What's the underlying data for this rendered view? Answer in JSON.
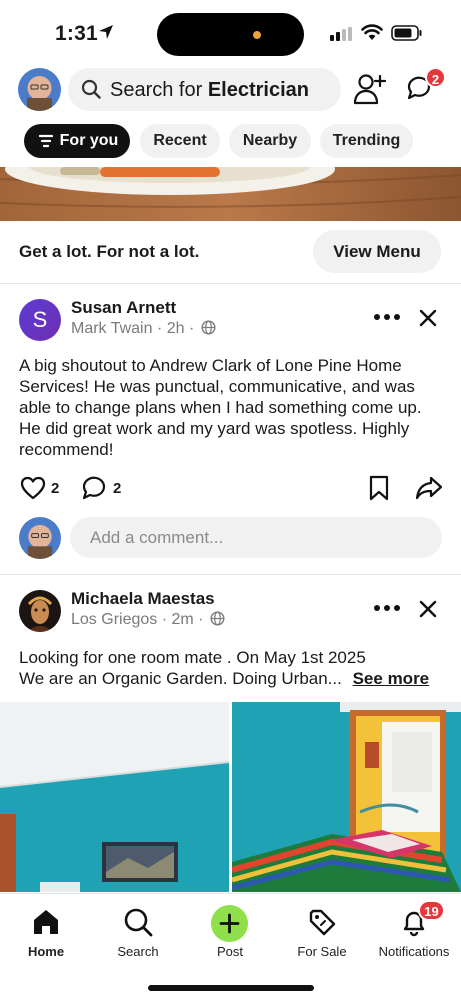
{
  "status_bar": {
    "time": "1:31"
  },
  "header": {
    "search_prefix": "Search for ",
    "search_term": "Electrician",
    "chat_badge": "2"
  },
  "chips": [
    {
      "label": "For you",
      "active": true
    },
    {
      "label": "Recent"
    },
    {
      "label": "Nearby"
    },
    {
      "label": "Trending"
    }
  ],
  "ad": {
    "tagline": "Get a lot. For not a lot.",
    "cta": "View Menu"
  },
  "posts": [
    {
      "avatar_letter": "S",
      "author": "Susan Arnett",
      "meta": "Mark Twain · 2h ·",
      "body": "A big shoutout to Andrew Clark of Lone Pine Home Services! He was punctual, communicative, and was able to change plans when I had something come up. He did great work and my yard was spotless. Highly recommend!",
      "likes": "2",
      "comments": "2",
      "comment_placeholder": "Add a comment..."
    },
    {
      "author": "Michaela Maestas",
      "meta": "Los Griegos · 2m ·",
      "body_line1": "Looking for one room mate . On May 1st 2025",
      "body_line2": "We are an Organic Garden. Doing Urban...",
      "see_more": "See more"
    }
  ],
  "tabbar": {
    "items": [
      {
        "label": "Home",
        "icon": "home-icon",
        "active": true
      },
      {
        "label": "Search",
        "icon": "search-icon"
      },
      {
        "label": "Post",
        "icon": "plus-icon"
      },
      {
        "label": "For Sale",
        "icon": "tag-icon"
      },
      {
        "label": "Notifications",
        "icon": "bell-icon"
      }
    ],
    "notifications_badge": "19"
  },
  "colors": {
    "accent_green": "#8fe04a",
    "badge_red": "#e5373c",
    "chip_bg": "#f1f1f1"
  }
}
